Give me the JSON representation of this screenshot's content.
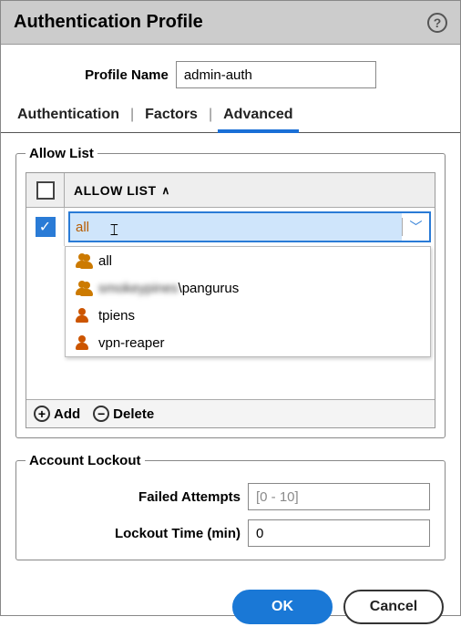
{
  "dialog": {
    "title": "Authentication Profile"
  },
  "profile": {
    "label": "Profile Name",
    "value": "admin-auth"
  },
  "tabs": [
    {
      "label": "Authentication",
      "active": false
    },
    {
      "label": "Factors",
      "active": false
    },
    {
      "label": "Advanced",
      "active": true
    }
  ],
  "allow_list": {
    "legend": "Allow List",
    "header_label": "ALLOW LIST",
    "row": {
      "checked": true,
      "value": "all"
    },
    "dropdown": [
      {
        "icon": "group",
        "label": "all",
        "obscured": false
      },
      {
        "icon": "group",
        "label": "\\pangurus",
        "obscured_prefix": "smokeypines"
      },
      {
        "icon": "single",
        "label": "tpiens",
        "obscured": false
      },
      {
        "icon": "single",
        "label": "vpn-reaper",
        "obscured": false
      }
    ],
    "footer": {
      "add": "Add",
      "delete": "Delete"
    }
  },
  "lockout": {
    "legend": "Account Lockout",
    "failed_label": "Failed Attempts",
    "failed_placeholder": "[0 - 10]",
    "failed_value": "",
    "time_label": "Lockout Time (min)",
    "time_value": "0"
  },
  "buttons": {
    "ok": "OK",
    "cancel": "Cancel"
  }
}
